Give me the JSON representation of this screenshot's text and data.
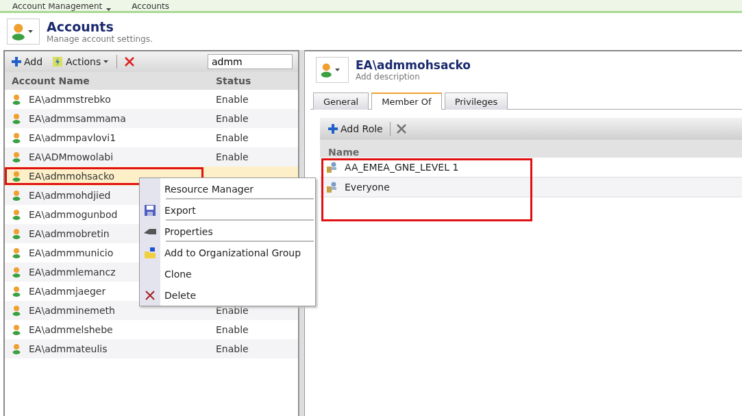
{
  "breadcrumb": [
    {
      "label": "Account Management",
      "dropdown": true
    },
    {
      "label": "Accounts",
      "dropdown": false
    }
  ],
  "header": {
    "title": "Accounts",
    "subtitle": "Manage account settings."
  },
  "toolbar": {
    "add": "Add",
    "actions": "Actions",
    "search": "admm"
  },
  "table": {
    "columns": [
      "Account Name",
      "Status"
    ],
    "rows": [
      {
        "name": "EA\\admmstrebko",
        "status": "Enable",
        "selected": false,
        "highlighted": false
      },
      {
        "name": "EA\\admmsammama",
        "status": "Enable",
        "selected": false,
        "highlighted": false
      },
      {
        "name": "EA\\admmpavlovi1",
        "status": "Enable",
        "selected": false,
        "highlighted": false
      },
      {
        "name": "EA\\ADMmowolabi",
        "status": "Enable",
        "selected": false,
        "highlighted": false
      },
      {
        "name": "EA\\admmohsacko",
        "selected": true,
        "highlighted": true
      },
      {
        "name": "EA\\admmohdjied",
        "selected": false,
        "highlighted": false
      },
      {
        "name": "EA\\admmogunbod",
        "selected": false,
        "highlighted": false
      },
      {
        "name": "EA\\admmobretin",
        "selected": false,
        "highlighted": false
      },
      {
        "name": "EA\\admmmunicio",
        "selected": false,
        "highlighted": false
      },
      {
        "name": "EA\\admmlemancz",
        "selected": false,
        "highlighted": false
      },
      {
        "name": "EA\\admmjaeger",
        "selected": false,
        "highlighted": false
      },
      {
        "name": "EA\\admminemeth",
        "status": "Enable",
        "selected": false,
        "highlighted": false
      },
      {
        "name": "EA\\admmelshebe",
        "status": "Enable",
        "selected": false,
        "highlighted": false
      },
      {
        "name": "EA\\admmateulis",
        "status": "Enable",
        "selected": false,
        "highlighted": false
      }
    ]
  },
  "context_menu": [
    {
      "label": "Resource Manager",
      "kind": "none",
      "separator": true
    },
    {
      "label": "Export",
      "kind": "save",
      "separator": true
    },
    {
      "label": "Properties",
      "kind": "properties",
      "separator": true
    },
    {
      "label": "Add to Organizational Group",
      "kind": "folder",
      "separator": false
    },
    {
      "label": "Clone",
      "kind": "none",
      "separator": false
    },
    {
      "label": "Delete",
      "kind": "delete",
      "separator": false
    }
  ],
  "detail": {
    "title": "EA\\admmohsacko",
    "description": "Add description",
    "tabs": [
      {
        "label": "General",
        "selected": false
      },
      {
        "label": "Member Of",
        "selected": true
      },
      {
        "label": "Privileges",
        "selected": false
      }
    ],
    "add_role": "Add Role",
    "column": "Name",
    "highlighted": true,
    "roles": [
      "AA_EMEA_GNE_LEVEL 1",
      "Everyone"
    ]
  }
}
